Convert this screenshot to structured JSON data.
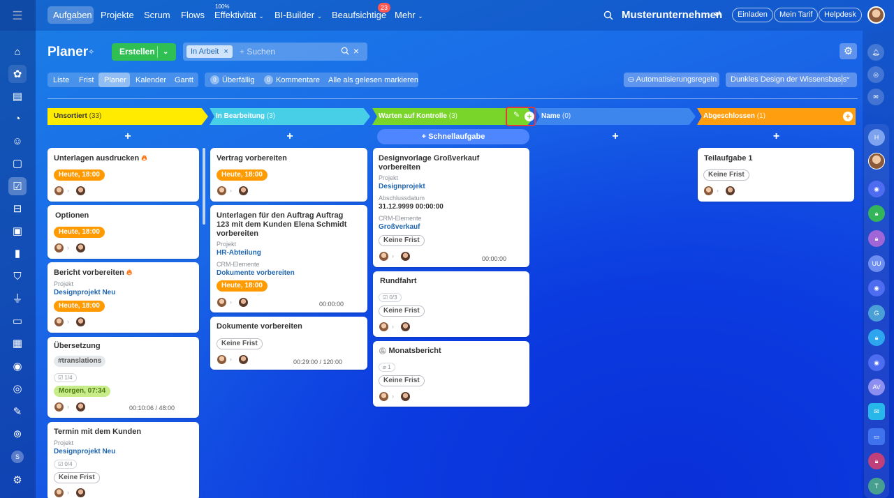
{
  "topnav": {
    "items": [
      "Aufgaben",
      "Projekte",
      "Scrum",
      "Flows",
      "Effektivität",
      "BI-Builder",
      "Beaufsichtige",
      "Mehr"
    ],
    "effektivitaet_pct": "100%",
    "beaufsichtige_badge": "23",
    "company": "Musterunternehmen",
    "invite": "Einladen",
    "tariff": "Mein Tarif",
    "helpdesk": "Helpdesk"
  },
  "page": {
    "title": "Planer",
    "create_btn": "Erstellen",
    "filter_chip": "In Arbeit",
    "search_placeholder": "+ Suchen"
  },
  "views": [
    "Liste",
    "Frist",
    "Planer",
    "Kalender",
    "Gantt"
  ],
  "counters": {
    "overdue_count": "0",
    "overdue_label": "Überfällig",
    "comments_count": "0",
    "comments_label": "Kommentare",
    "mark_read": "Alle als gelesen markieren"
  },
  "automation": "Automatisierungsregeln",
  "theme": "Dunkles Design der Wissensbasis",
  "quick_task": "+ Schnellaufgabe",
  "columns": [
    {
      "name": "Unsortiert",
      "count": "(33)",
      "color": "#ffeb00",
      "text": "#333"
    },
    {
      "name": "In Bearbeitung",
      "count": "(3)",
      "color": "#47cfe8",
      "text": "#fff"
    },
    {
      "name": "Warten auf Kontrolle",
      "count": "(3)",
      "color": "#7ad52b",
      "text": "#fff"
    },
    {
      "name": "Name",
      "count": "(0)",
      "color": "#3d86ee",
      "text": "#fff"
    },
    {
      "name": "Abgeschlossen",
      "count": "(1)",
      "color": "#ff9f10",
      "text": "#fff"
    }
  ],
  "cards": {
    "c1": {
      "title": "Unterlagen ausdrucken",
      "deadline": "Heute, 18:00"
    },
    "c2": {
      "title": "Optionen",
      "deadline": "Heute, 18:00"
    },
    "c3": {
      "title": "Bericht vorbereiten",
      "proj_label": "Projekt",
      "proj": "Designprojekt Neu",
      "deadline": "Heute, 18:00"
    },
    "c4": {
      "title": "Übersetzung",
      "tag": "#translations",
      "checklist": "1/4",
      "deadline": "Morgen, 07:34",
      "time": "00:10:06 / 48:00"
    },
    "c5": {
      "title": "Termin mit dem Kunden",
      "proj_label": "Projekt",
      "proj": "Designprojekt Neu",
      "checklist": "0/4",
      "deadline": "Keine Frist"
    },
    "c6": {
      "title": "Vertrag vorbereiten",
      "deadline": "Heute, 18:00"
    },
    "c7": {
      "title": "Unterlagen für den Auftrag Auftrag 123 mit dem Kunden Elena Schmidt vorbereiten",
      "proj_label": "Projekt",
      "proj": "HR-Abteilung",
      "crm_label": "CRM-Elemente",
      "crm": "Dokumente vorbereiten",
      "deadline": "Heute, 18:00",
      "time": "00:00:00"
    },
    "c8": {
      "title": "Dokumente vorbereiten",
      "deadline": "Keine Frist",
      "time": "00:29:00 / 120:00"
    },
    "c9": {
      "title": "Designvorlage Großverkauf vorbereiten",
      "proj_label": "Projekt",
      "proj": "Designprojekt",
      "close_label": "Abschlussdatum",
      "close": "31.12.9999 00:00:00",
      "crm_label": "CRM-Elemente",
      "crm": "Großverkauf",
      "deadline": "Keine Frist",
      "time": "00:00:00"
    },
    "c10": {
      "title": "Rundfahrt",
      "checklist": "0/3",
      "deadline": "Keine Frist"
    },
    "c11": {
      "title": "Monatsbericht",
      "files": "1",
      "deadline": "Keine Frist"
    },
    "c12": {
      "title": "Teilaufgabe 1",
      "deadline": "Keine Frist"
    }
  },
  "right_avatars": [
    "H",
    "UU",
    "G",
    "AV",
    "T"
  ],
  "left_badge": "S"
}
